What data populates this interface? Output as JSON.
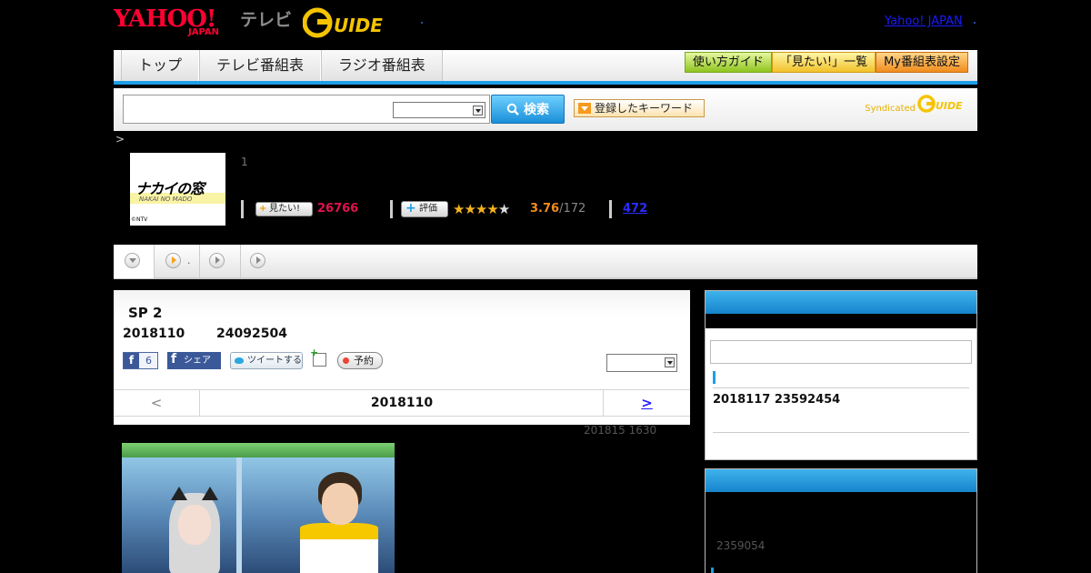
{
  "header": {
    "yahoo_logo": "YAHOO!",
    "yahoo_logo_sub": "JAPAN",
    "tv_label": "テレビ",
    "gguide_logo": "G-GUIDE",
    "yahoo_japan_link": "Yahoo! JAPAN"
  },
  "nav": {
    "tabs": [
      "トップ",
      "テレビ番組表",
      "ラジオ番組表"
    ],
    "buttons": [
      "使い方ガイド",
      "「見たい!」一覧",
      "My番組表設定"
    ]
  },
  "search": {
    "value": "",
    "select_value": "",
    "button_label": "検索",
    "keyword_button_label": "登録したキーワード",
    "syndicated_label": "Syndicated",
    "syndicated_logo": "G-GUIDE"
  },
  "breadcrumb": ">",
  "program": {
    "logo_text": "ナカイの窓",
    "logo_subtext": "NAKAI NO MADO",
    "logo_credit": "©NTV",
    "episode_number": "1",
    "mitai_label": "見たい!",
    "mitai_count": "26766",
    "hyoka_label": "評価",
    "rating_stars": 3.76,
    "rating_value": "3.76",
    "rating_count": "/172",
    "review_count": "472"
  },
  "program_tabs": {
    "second_tab_label": "."
  },
  "episode": {
    "title": "SP 2",
    "date": "2018110",
    "time": "24092504",
    "fb_like_count": "6",
    "fb_share_label": "シェア",
    "tweet_label": "ツイートする",
    "reserve_label": "予約",
    "select_value": "",
    "prev_label": "<",
    "current_label": "2018110",
    "next_label": ">",
    "updated": "201815  1630"
  },
  "sidebar": {
    "input_value": "",
    "item": "2018117  23592454",
    "box2_text": "2359054"
  },
  "colors": {
    "accent_blue": "#1e9ee6",
    "mitai_red": "#e0124e",
    "rating_orange": "#f18c1e"
  }
}
